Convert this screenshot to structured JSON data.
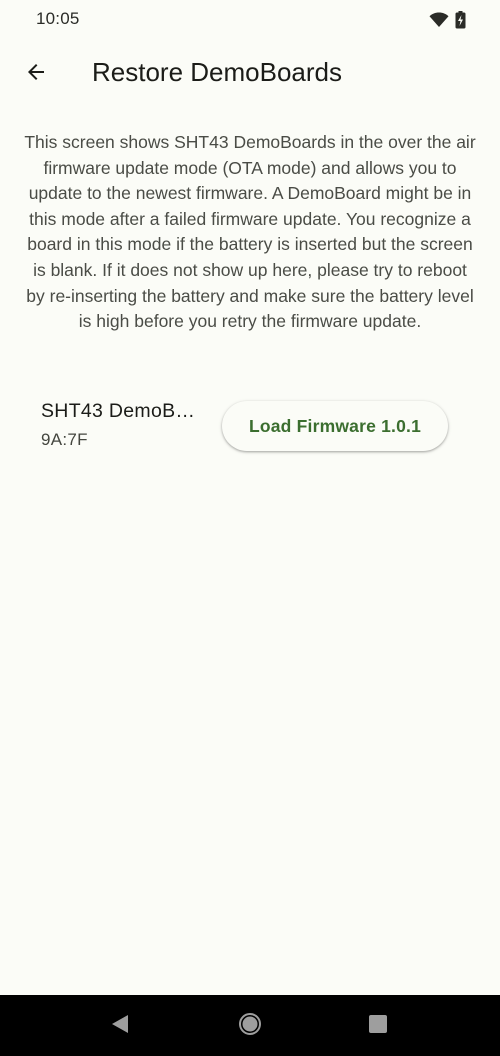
{
  "status_bar": {
    "time": "10:05",
    "icons": [
      "wifi-icon",
      "battery-charging-icon"
    ]
  },
  "app_bar": {
    "back_icon": "arrow-back-icon",
    "title": "Restore DemoBoards"
  },
  "description": "This screen shows SHT43 DemoBoards in the over the air firmware update mode (OTA mode) and allows you to update to the newest firmware. A DemoBoard might be in this mode after a failed firmware update. You recognize a board in this mode if the battery is inserted but the screen is blank. If it does not show up here, please try to reboot by re-inserting the battery and make sure the battery level is high before you retry the firmware update.",
  "devices": [
    {
      "name": "SHT43 DemoB…",
      "id": "9A:7F",
      "action_label": "Load Firmware 1.0.1"
    }
  ],
  "nav_bar": {
    "buttons": [
      "nav-back-icon",
      "nav-home-icon",
      "nav-recents-icon"
    ]
  },
  "colors": {
    "background": "#fbfcf7",
    "accent": "#3b6e2f",
    "text_primary": "#1b1c18",
    "text_secondary": "#4a4c46",
    "nav_bar": "#000000"
  }
}
